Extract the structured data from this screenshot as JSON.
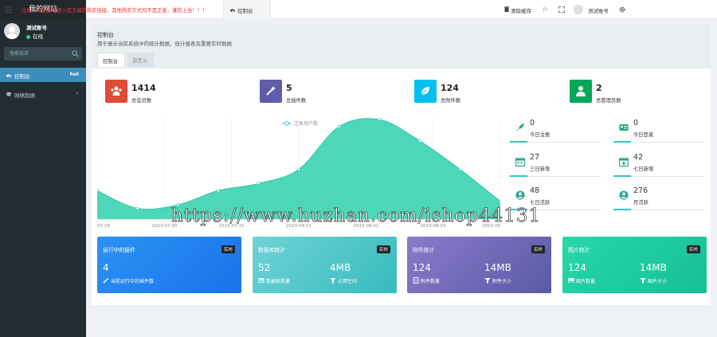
{
  "sidebar": {
    "site_title": "我的网站",
    "user_name": "测试账号",
    "user_status": "在线",
    "search_placeholder": "搜索菜单",
    "items": [
      {
        "label": "控制台",
        "badge": "hot",
        "icon": "dashboard-icon"
      },
      {
        "label": "网络舆据",
        "icon": "graduation-cap-icon"
      }
    ]
  },
  "topbar": {
    "notice": "注意：点击此处进入官方捕获购买链接，其他购买方式均不是正版，谨防上当！！！",
    "active_tab": "控制台",
    "clear_cache": "清除缓存",
    "user": "测试账号"
  },
  "panel": {
    "title": "控制台",
    "description": "用于展示当前系统中的统计数据、统计报表及重要实时数据",
    "tabs": [
      "控制台",
      "自定义"
    ]
  },
  "stats": [
    {
      "value": "1414",
      "label": "总会员数",
      "color": "#dd4b39",
      "icon": "users-icon"
    },
    {
      "value": "5",
      "label": "总插件数",
      "color": "#605ca8",
      "icon": "magic-wand-icon"
    },
    {
      "value": "124",
      "label": "总附件数",
      "color": "#00c0ef",
      "icon": "leaf-icon"
    },
    {
      "value": "2",
      "label": "总管理员数",
      "color": "#00a65a",
      "icon": "user-icon"
    }
  ],
  "right_stats": [
    {
      "value": "0",
      "label": "今日注册",
      "icon": "rocket-icon"
    },
    {
      "value": "0",
      "label": "今日登录",
      "icon": "id-card-icon"
    },
    {
      "value": "27",
      "label": "三日新增",
      "icon": "calendar-icon"
    },
    {
      "value": "42",
      "label": "七日新增",
      "icon": "calendar-plus-icon"
    },
    {
      "value": "48",
      "label": "七日活跃",
      "icon": "user-circle-icon"
    },
    {
      "value": "276",
      "label": "月活跃",
      "icon": "user-circle-icon"
    }
  ],
  "cards": [
    {
      "title": "运行中的插件",
      "badge": "实时",
      "gradient": [
        "#2b92f4",
        "#1a73e8"
      ],
      "items": [
        {
          "value": "4",
          "label": "当前运行中的插件数",
          "icon": "magic-wand-icon"
        }
      ]
    },
    {
      "title": "数据库统计",
      "badge": "实时",
      "gradient": [
        "#6fd3d6",
        "#36bbbd"
      ],
      "items": [
        {
          "value": "52",
          "label": "数据表数量",
          "icon": "table-icon"
        },
        {
          "value": "4MB",
          "label": "占用空间",
          "icon": "filter-icon"
        }
      ]
    },
    {
      "title": "附件统计",
      "badge": "实时",
      "gradient": [
        "#8b79cc",
        "#5a5aa6"
      ],
      "items": [
        {
          "value": "124",
          "label": "附件数量",
          "icon": "file-icon"
        },
        {
          "value": "14MB",
          "label": "附件大小",
          "icon": "filter-icon"
        }
      ]
    },
    {
      "title": "图片统计",
      "badge": "实时",
      "gradient": [
        "#28d7ab",
        "#15bf97"
      ],
      "items": [
        {
          "value": "124",
          "label": "图片数量",
          "icon": "image-icon"
        },
        {
          "value": "14MB",
          "label": "图片大小",
          "icon": "filter-icon"
        }
      ]
    }
  ],
  "chart_data": {
    "type": "area",
    "series": [
      {
        "name": "注册用户数",
        "values": [
          8,
          3,
          4,
          8,
          10,
          14,
          26,
          28,
          22,
          14,
          5
        ]
      }
    ],
    "x": [
      "07-29",
      "",
      "2023-07-30",
      "",
      "2023-07-31",
      "",
      "2023-08-01",
      "",
      "2023-08-02",
      "",
      "2023-08-03",
      "",
      "2023-08"
    ],
    "ylim": [
      0,
      28
    ],
    "color": "#2ec7a7",
    "grid": true,
    "legend_position": "top-center"
  },
  "watermark": "https://www.huzhan.com/ishop44131"
}
